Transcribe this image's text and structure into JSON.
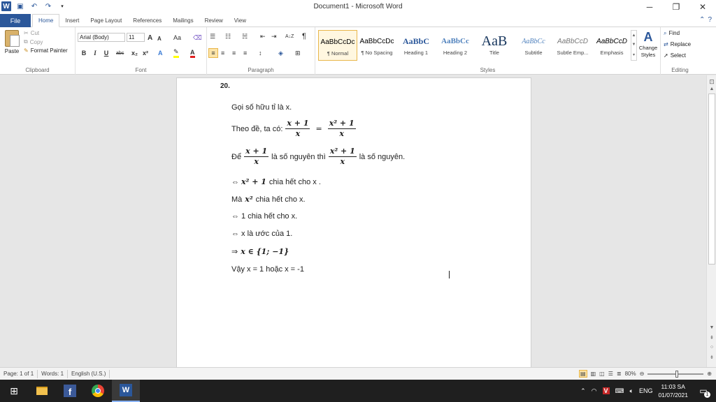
{
  "window": {
    "title": "Document1 - Microsoft Word"
  },
  "ribbon_tabs": {
    "file": "File",
    "items": [
      "Home",
      "Insert",
      "Page Layout",
      "References",
      "Mailings",
      "Review",
      "View"
    ]
  },
  "clipboard": {
    "paste": "Paste",
    "cut": "Cut",
    "copy": "Copy",
    "format_painter": "Format Painter",
    "group_label": "Clipboard"
  },
  "font": {
    "family": "Arial (Body)",
    "size": "11",
    "group_label": "Font",
    "bold": "B",
    "italic": "I",
    "underline": "U",
    "strike": "abc",
    "sub": "x₂",
    "sup": "x²",
    "grow": "A",
    "shrink": "A",
    "case": "Aa",
    "color_a": "A"
  },
  "paragraph": {
    "group_label": "Paragraph",
    "pilcrow": "¶",
    "sort": "A↓Z"
  },
  "styles": {
    "group_label": "Styles",
    "items": [
      {
        "sample": "AaBbCcDc",
        "name": "¶ Normal"
      },
      {
        "sample": "AaBbCcDc",
        "name": "¶ No Spacing"
      },
      {
        "sample": "AaBbC",
        "name": "Heading 1"
      },
      {
        "sample": "AaBbCc",
        "name": "Heading 2"
      },
      {
        "sample": "AaB",
        "name": "Title"
      },
      {
        "sample": "AaBbCc",
        "name": "Subtitle"
      },
      {
        "sample": "AaBbCcD",
        "name": "Subtle Emp..."
      },
      {
        "sample": "AaBbCcD",
        "name": "Emphasis"
      }
    ],
    "change_styles": "Change Styles"
  },
  "editing": {
    "group_label": "Editing",
    "find": "Find",
    "replace": "Replace",
    "select": "Select"
  },
  "document": {
    "number_label": "20.",
    "line1": "Gọi số hữu tỉ là x.",
    "line2_prefix": "Theo đề, ta có:",
    "frac1_num": "x + 1",
    "frac1_den": "x",
    "eq_sign": "=",
    "frac2_num": "x² + 1",
    "frac2_den": "x",
    "line3_prefix": "Để",
    "line3_mid": "là số nguyên thì",
    "line3_suffix": "là số nguyên.",
    "line4_prefix": "⇔",
    "line4_math": "x² + 1",
    "line4_suffix": "chia hết cho x .",
    "line5_prefix": "Mà",
    "line5_math": "x²",
    "line5_suffix": "chia hết cho x.",
    "line6": "⇔ 1 chia hết cho x.",
    "line7": "⇔ x là ước của 1.",
    "line8_prefix": "⇒",
    "line8_math": "x ∈ {1; −1}",
    "line9": "Vậy x = 1 hoặc x = -1"
  },
  "status": {
    "page": "Page: 1 of 1",
    "words": "Words: 1",
    "language": "English (U.S.)",
    "zoom": "80%"
  },
  "taskbar": {
    "language": "ENG",
    "time": "11:03 SA",
    "date": "01/07/2021",
    "notification_count": "1"
  },
  "colors": {
    "accent": "#2b579a",
    "taskbar": "#1f1f1f",
    "style_selected": "#e8b64a"
  }
}
